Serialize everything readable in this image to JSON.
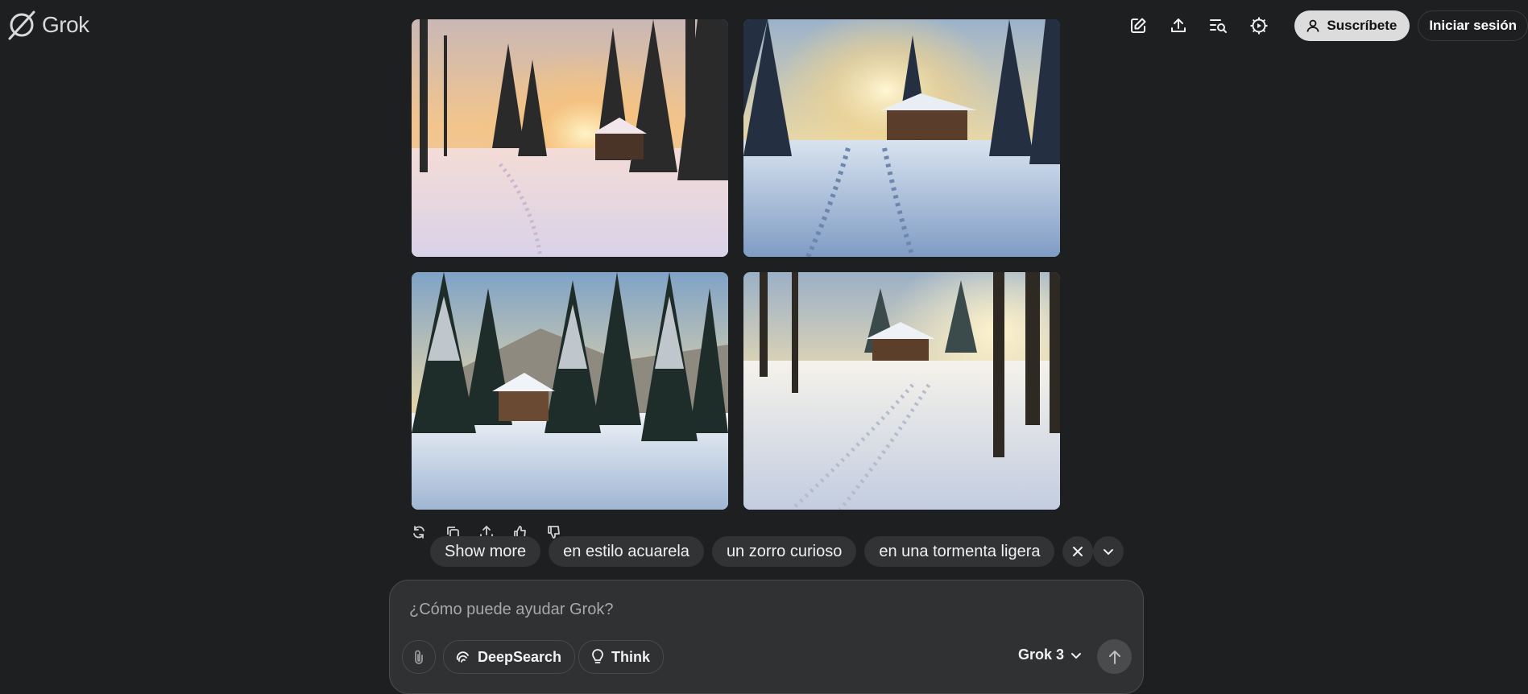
{
  "app": {
    "name": "Grok"
  },
  "header": {
    "actions": [
      {
        "icon": "new-chat-icon"
      },
      {
        "icon": "share-icon"
      },
      {
        "icon": "search-history-icon"
      },
      {
        "icon": "settings-icon"
      }
    ],
    "subscribe_label": "Suscríbete",
    "login_label": "Iniciar sesión"
  },
  "images": [
    {
      "icon": "generated-image",
      "theme": "sunset"
    },
    {
      "icon": "generated-image",
      "theme": "cabin-sun"
    },
    {
      "icon": "generated-image",
      "theme": "pines-cabin"
    },
    {
      "icon": "generated-image",
      "theme": "trail-cabin"
    }
  ],
  "message_actions": [
    "regenerate-icon",
    "copy-icon",
    "share-icon",
    "thumbs-up-icon",
    "thumbs-down-icon"
  ],
  "suggestions": {
    "items": [
      "Show more",
      "en estilo acuarela",
      "un zorro curioso",
      "en una tormenta ligera"
    ]
  },
  "composer": {
    "placeholder": "¿Cómo puede ayudar Grok?",
    "value": "",
    "deepsearch_label": "DeepSearch",
    "think_label": "Think",
    "model_label": "Grok 3"
  },
  "colors": {
    "background": "#1e1f20",
    "chip": "#323334",
    "composer": "#303132",
    "subscribe_bg": "#dcdcdc"
  }
}
